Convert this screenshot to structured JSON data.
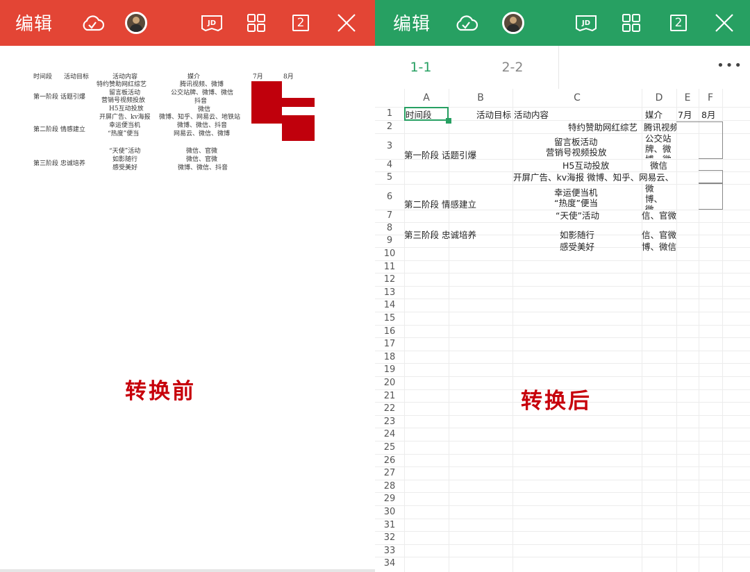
{
  "left_toolbar": {
    "title": "编辑",
    "tab_count": "2"
  },
  "right_toolbar": {
    "title": "编辑",
    "tab_count": "2"
  },
  "preview": {
    "header": [
      "时间段",
      "活动目标",
      "活动内容",
      "媒介",
      "7月",
      "8月"
    ],
    "content_lines": [
      "特约赞助网红综艺",
      "留言板活动",
      "营销号视频投放",
      "H5互动投放",
      "开屏广告、kv海报",
      "幸运便当机",
      "“热度”便当",
      "“天使”活动",
      "如影随行",
      "感受美好"
    ],
    "media_lines": [
      "腾讯视频、微博",
      "公交站牌、微博、微信",
      "抖音",
      "微信",
      "微博、知乎、网易云、地铁站",
      "微博、微信、抖音",
      "网易云、微信、微博",
      "微信、官微",
      "微信、官微",
      "微博、微信、抖音"
    ],
    "phase_lines": [
      "第一阶段 话题引爆",
      "第二阶段 情感建立",
      "第三阶段 忠诚培养"
    ],
    "caption": "转换前"
  },
  "sheet_tabs": [
    {
      "label": "1-1"
    },
    {
      "label": "2-2"
    }
  ],
  "more_label": "•••",
  "columns": [
    "A",
    "B",
    "C",
    "D",
    "E",
    "F"
  ],
  "rows": [
    "1",
    "2",
    "3",
    "4",
    "5",
    "6",
    "7",
    "8",
    "9",
    "10",
    "11",
    "12",
    "13",
    "14",
    "15",
    "16",
    "17",
    "18",
    "19",
    "20",
    "21",
    "22",
    "23",
    "24",
    "25",
    "26",
    "27",
    "28",
    "29",
    "30",
    "31",
    "32",
    "33",
    "34"
  ],
  "cells": {
    "a1": "时间段",
    "b1": "活动目标",
    "c1": "活动内容",
    "d1": "媒介",
    "e1": "7月",
    "f1": "8月",
    "c2": "特约赞助网红综艺",
    "d2": "腾讯视频、微",
    "c3a": "留言板活动",
    "c3b": "营销号视频投放",
    "d3": "公交站牌、微博、微",
    "a3": "第一阶段",
    "b3": "话题引爆",
    "c4": "H5互动投放",
    "d4": "微信",
    "c5": "开屏广告、kv海报 微博、知乎、网易云、",
    "a6": "第二阶段",
    "b6": "情感建立",
    "c6a": "幸运便当机",
    "c6b": "“热度”便当",
    "d6": "微博、微信、抖音",
    "c7": "“天使”活动",
    "d7": "微信、官微",
    "a8": "第三阶段",
    "b8": "忠诚培养",
    "c8": "如影随行",
    "d8": "微信、官微",
    "c9": "感受美好",
    "d9": "微博、微信、"
  },
  "caption_right": "转换后",
  "colors": {
    "left_bar": "#e34535",
    "right_bar": "#27a062",
    "red_block": "#c0000c",
    "caption": "#c7000b"
  }
}
